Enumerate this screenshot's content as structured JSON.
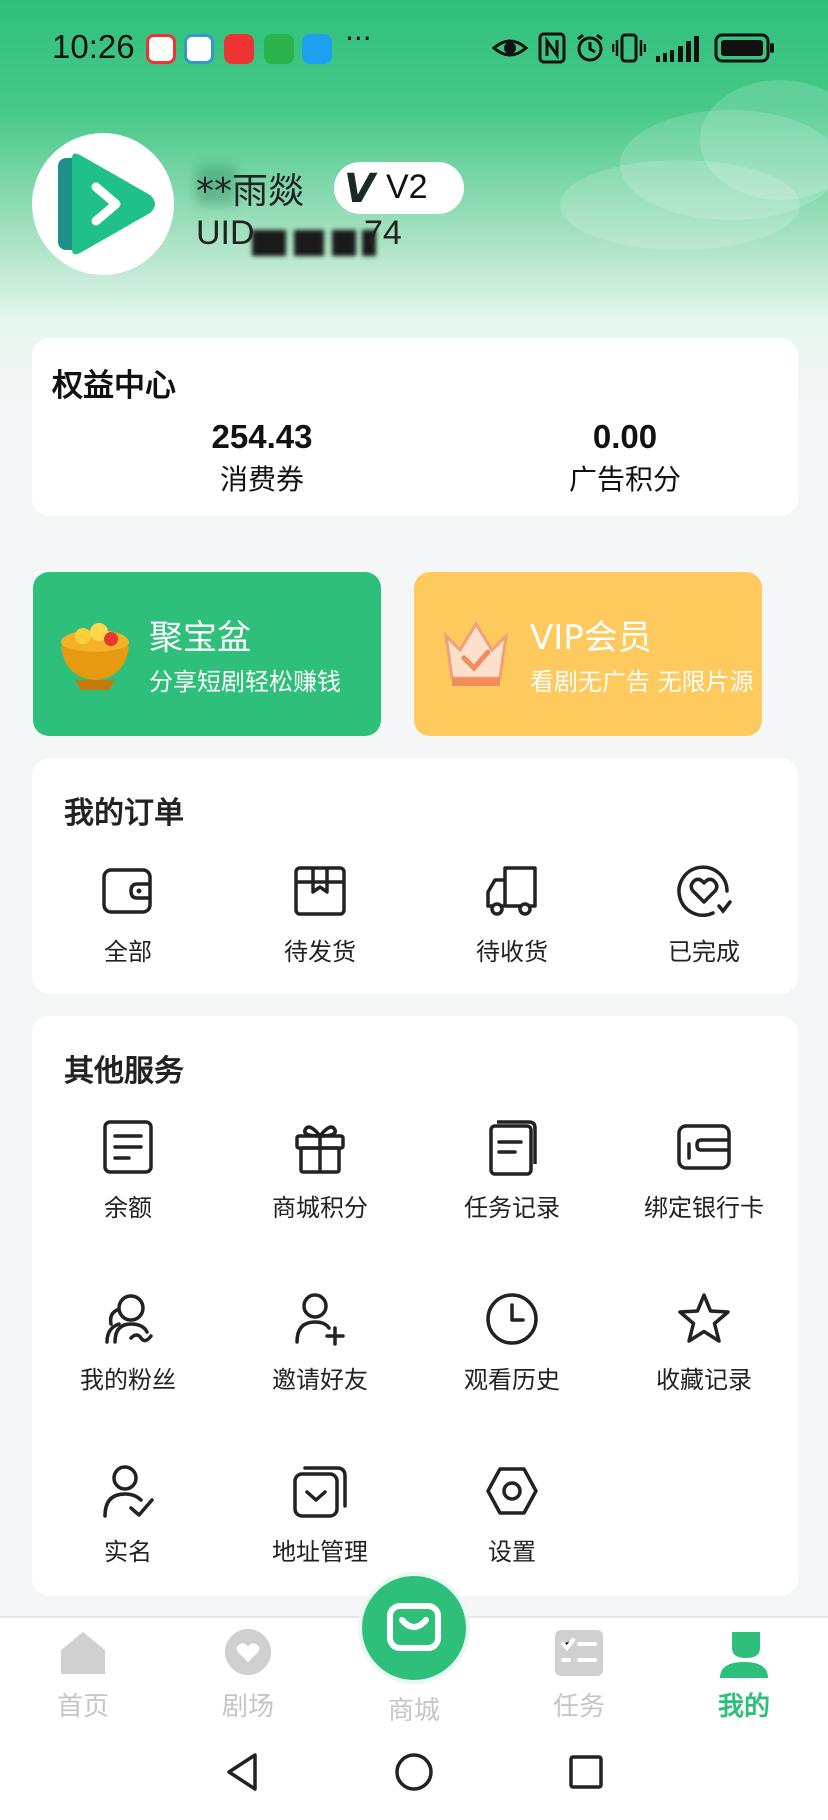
{
  "status_bar": {
    "time": "10:26",
    "more_indicator": "···",
    "icons": [
      "eye-icon",
      "nfc-icon",
      "alarm-icon",
      "vibrate-icon",
      "signal-icon",
      "battery-icon"
    ]
  },
  "profile": {
    "name": "**雨燚",
    "level_badge": "V2",
    "level_mark": "V",
    "uid": "UID**********74",
    "uid_prefix": "UID",
    "uid_suffix": "74"
  },
  "benefits": {
    "title": "权益中心",
    "items": [
      {
        "value": "254.43",
        "label": "消费券"
      },
      {
        "value": "0.00",
        "label": "广告积分"
      }
    ]
  },
  "promos": [
    {
      "title": "聚宝盆",
      "subtitle": "分享短剧轻松赚钱",
      "color": "#2ec07a",
      "icon": "treasure-bowl-icon"
    },
    {
      "title": "VIP会员",
      "subtitle": "看剧无广告 无限片源",
      "color": "#fec95d",
      "icon": "crown-icon"
    }
  ],
  "orders": {
    "title": "我的订单",
    "items": [
      {
        "label": "全部",
        "icon": "wallet-icon"
      },
      {
        "label": "待发货",
        "icon": "package-icon"
      },
      {
        "label": "待收货",
        "icon": "truck-icon"
      },
      {
        "label": "已完成",
        "icon": "heart-check-icon"
      }
    ]
  },
  "services": {
    "title": "其他服务",
    "items": [
      {
        "label": "余额",
        "icon": "balance-icon"
      },
      {
        "label": "商城积分",
        "icon": "gift-icon"
      },
      {
        "label": "任务记录",
        "icon": "document-icon"
      },
      {
        "label": "绑定银行卡",
        "icon": "card-icon"
      },
      {
        "label": "我的粉丝",
        "icon": "fans-icon"
      },
      {
        "label": "邀请好友",
        "icon": "add-user-icon"
      },
      {
        "label": "观看历史",
        "icon": "clock-icon"
      },
      {
        "label": "收藏记录",
        "icon": "star-icon"
      },
      {
        "label": "实名",
        "icon": "user-check-icon"
      },
      {
        "label": "地址管理",
        "icon": "address-icon"
      },
      {
        "label": "设置",
        "icon": "settings-icon"
      }
    ]
  },
  "bottom_nav": {
    "items": [
      {
        "label": "首页",
        "icon": "home-icon"
      },
      {
        "label": "剧场",
        "icon": "theater-icon"
      },
      {
        "label": "商城",
        "icon": "shopping-bag-icon"
      },
      {
        "label": "任务",
        "icon": "task-icon"
      },
      {
        "label": "我的",
        "icon": "profile-icon"
      }
    ],
    "active_label": "我的",
    "active_color": "#2ec07a",
    "inactive_color": "#c6c6c6"
  },
  "system_nav": [
    "back-icon",
    "home-circle-icon",
    "recents-icon"
  ],
  "colors": {
    "brand": "#2ec07a",
    "vip": "#fec95d"
  }
}
